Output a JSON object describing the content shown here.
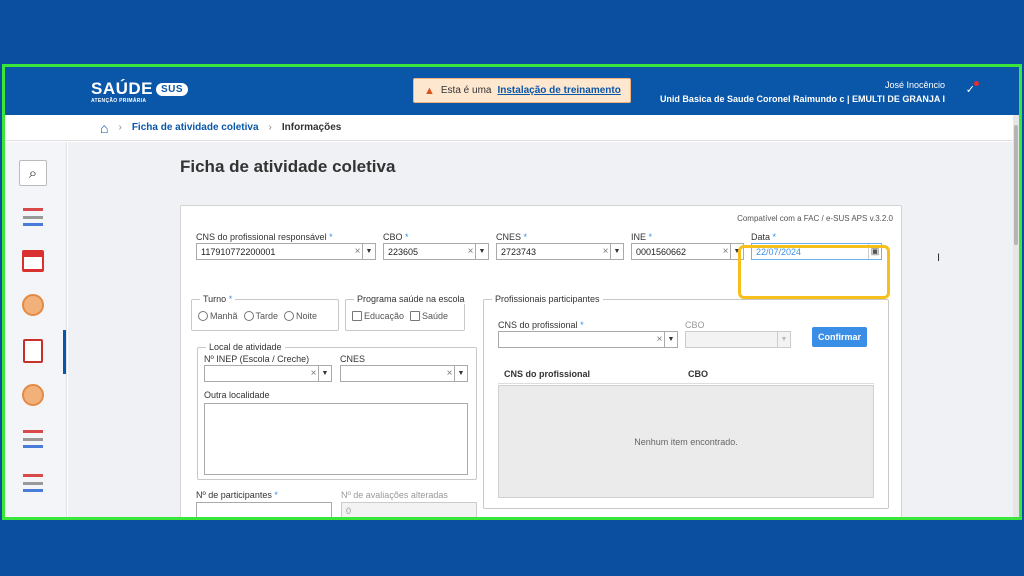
{
  "header": {
    "logo_text": "SAÚDE",
    "logo_badge": "SUS",
    "logo_sub": "ATENÇÃO PRIMÁRIA",
    "warning_text": "Esta é uma",
    "warning_link": "Instalação de treinamento",
    "user_name": "José Inocêncio",
    "unit_name": "Unid Basica de Saude Coronel Raimundo c | EMULTI DE GRANJA I"
  },
  "breadcrumb": {
    "items": [
      "Ficha de atividade coletiva",
      "Informações"
    ]
  },
  "page": {
    "title": "Ficha de atividade coletiva"
  },
  "form": {
    "compat": "Compatível com a FAC / e-SUS APS v.3.2.0",
    "cns_label": "CNS do profissional responsável",
    "cns_value": "117910772200001",
    "cbo_label": "CBO",
    "cbo_value": "223605",
    "cnes_label": "CNES",
    "cnes_value": "2723743",
    "ine_label": "INE",
    "ine_value": "0001560662",
    "data_label": "Data",
    "data_value": "22/07/2024",
    "turno_legend": "Turno",
    "turno_options": [
      "Manhã",
      "Tarde",
      "Noite"
    ],
    "programa_legend": "Programa saúde na escola",
    "programa_options": [
      "Educação",
      "Saúde"
    ],
    "local_legend": "Local de atividade",
    "inep_label": "Nº INEP (Escola / Creche)",
    "local_cnes_label": "CNES",
    "outra_label": "Outra localidade",
    "participantes_label": "Nº de participantes",
    "avaliacoes_label": "Nº de avaliações alteradas",
    "avaliacoes_value": "0",
    "required_mark": "*",
    "profissionais": {
      "legend": "Profissionais participantes",
      "cns_label": "CNS do profissional",
      "cbo_label": "CBO",
      "confirm_button": "Confirmar",
      "col_cns": "CNS do profissional",
      "col_cbo": "CBO",
      "empty_text": "Nenhum item encontrado."
    }
  },
  "highlight_color": "#f6bf1c",
  "border_color": "#39e639"
}
